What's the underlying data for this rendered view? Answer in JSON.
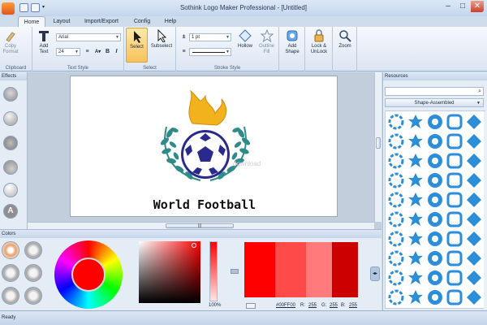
{
  "window": {
    "title": "Sothink Logo Maker Professional - [Untitled]",
    "controls": [
      "–",
      "□",
      "✕"
    ]
  },
  "tabs": [
    "Home",
    "Layout",
    "Import/Export",
    "Config",
    "Help"
  ],
  "ribbon": {
    "clipboard": {
      "label": "Clipboard",
      "copy_format": "Copy Format"
    },
    "text_style": {
      "label": "Text Style",
      "add_text": "Add Text",
      "font": "Arial",
      "size": "24",
      "bold": "B",
      "italic": "I"
    },
    "select": {
      "label": "Select",
      "select": "Select",
      "subselect": "Subselect"
    },
    "stroke_style": {
      "label": "Stroke Style",
      "width": "1 pt",
      "hollow": "Hollow",
      "outline_fill": "Outline Fill"
    },
    "add_shape": "Add Shape",
    "lock_unlock": "Lock & UnLock",
    "zoom": "Zoom"
  },
  "effects_panel": {
    "title": "Effects"
  },
  "canvas": {
    "logo_text": "World  Football",
    "watermark": "download",
    "colors": {
      "flame": "#f2b21c",
      "laurel": "#2e8b8a",
      "ball": "#2a2a8c",
      "text": "#111111"
    }
  },
  "resources_panel": {
    "title": "Resources",
    "category": "Shape-Assembled",
    "shape_color": "#2c8ed8"
  },
  "colors_panel": {
    "title": "Colors",
    "alpha_label": "100",
    "alpha_unit": "%",
    "hex": "#00FF00",
    "r_label": "R:",
    "r": "255",
    "g_label": "G:",
    "g": "255",
    "b_label": "B:",
    "b": "255",
    "swatches": [
      "#ff0000",
      "#ff4a4a",
      "#ff7a7a",
      "#cc0000"
    ]
  },
  "status": {
    "text": "Ready"
  }
}
